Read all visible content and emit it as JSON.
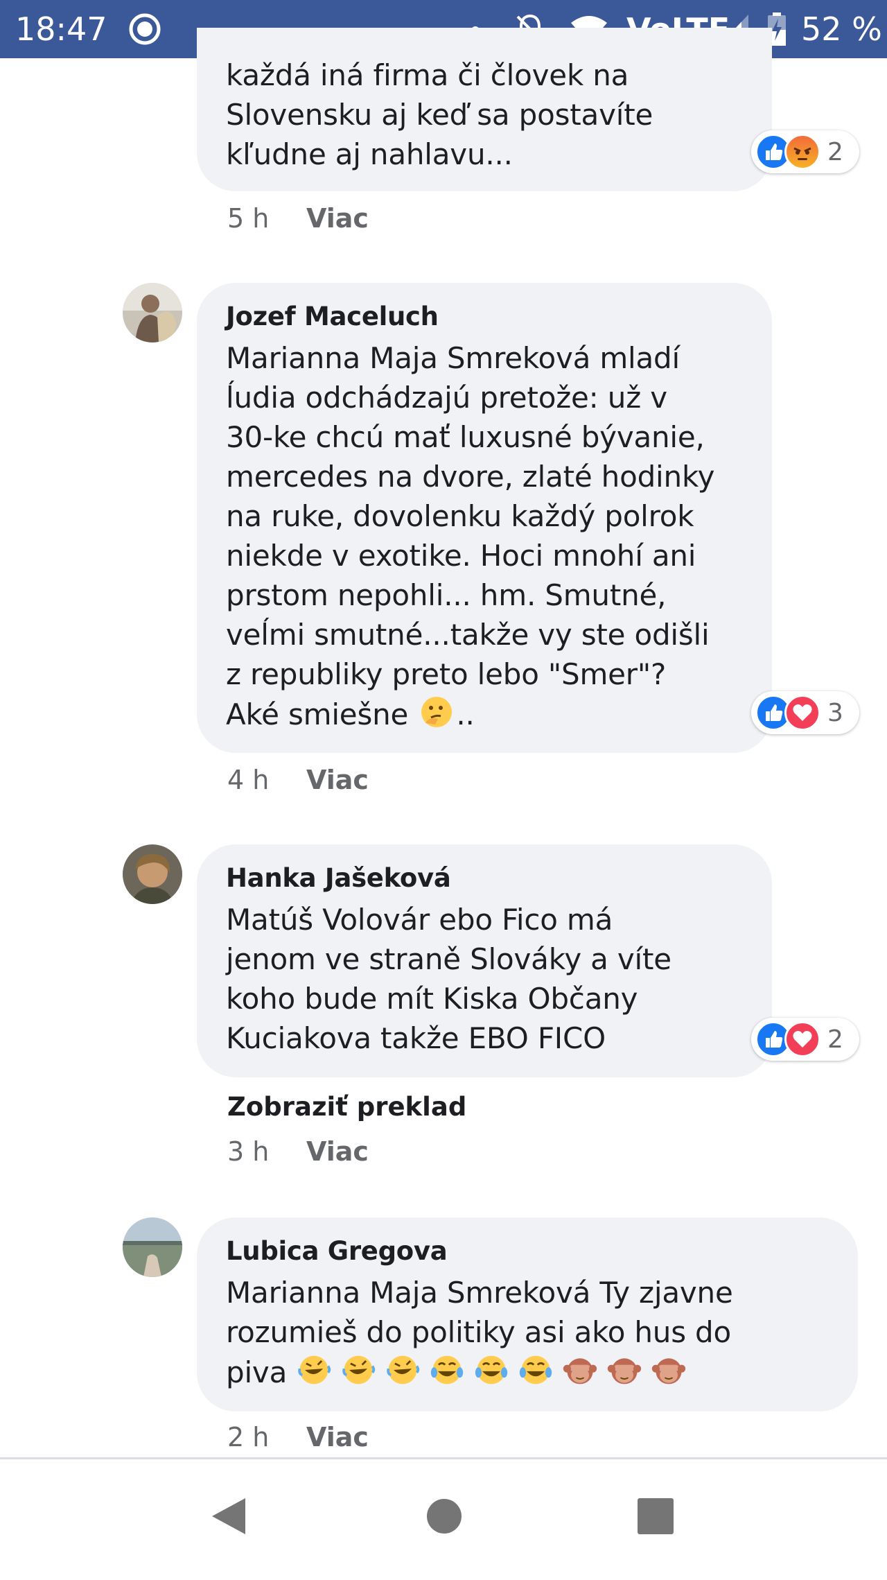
{
  "status_bar": {
    "time": "18:47",
    "battery_percent": "52 %",
    "network_label": "VoLTE",
    "signal_level": 0.75,
    "icons": [
      "sync-ring-icon",
      "notification-dot-icon",
      "silent-bell-icon",
      "wifi-icon",
      "volte-icon",
      "signal-icon",
      "battery-charging-icon"
    ]
  },
  "theme": {
    "brand_blue": "#3b5998",
    "bubble_bg": "#f0f2f5",
    "meta_gray": "#65676b",
    "like_blue": "#1877f2",
    "love_red": "#f33e58"
  },
  "comments": [
    {
      "author": "",
      "text_lines": "každá iná firma či človek na\nSlovensku aj keď sa postavíte\nkľudne aj nahlavu...",
      "reactions": [
        "like",
        "angry"
      ],
      "reaction_count": "2",
      "time": "5 h",
      "more_label": "Viac"
    },
    {
      "author": "Jozef Maceluch",
      "text_lines": "Marianna Maja Smreková mladí\nĺudia odchádzajú pretože: už v\n30-ke chcú mať luxusné bývanie,\nmercedes na dvore, zlaté hodinky\nna ruke, dovolenku každý polrok\nniekde v exotike. Hoci mnohí ani\nprstom nepohli... hm. Smutné,\nveĺmi smutné...takže vy ste odišli\nz republiky preto lebo \"Smer\"?",
      "last_line_prefix": "Aké smiešne ",
      "last_line_suffix": "..",
      "emoji": [
        "thinking-face-emoji"
      ],
      "reactions": [
        "like",
        "love"
      ],
      "reaction_count": "3",
      "time": "4 h",
      "more_label": "Viac"
    },
    {
      "author": "Hanka Jašeková",
      "text_lines": "Matúš Volovár ebo Fico má\njenom ve straně Slováky a víte\nkoho bude mít Kiska Občany\nKuciakova takže EBO FICO",
      "reactions": [
        "like",
        "love"
      ],
      "reaction_count": "2",
      "translate_label": "Zobraziť preklad",
      "time": "3 h",
      "more_label": "Viac"
    },
    {
      "author": "Lubica Gregova",
      "text_lines": "Marianna Maja Smreková Ty zjavne\nrozumieš do politiky asi ako hus do",
      "last_line_prefix": "piva ",
      "emoji": [
        "rofl-emoji",
        "rofl-emoji",
        "rofl-emoji",
        "tears-of-joy-emoji",
        "tears-of-joy-emoji",
        "tears-of-joy-emoji",
        "see-no-evil-monkey-emoji",
        "see-no-evil-monkey-emoji",
        "see-no-evil-monkey-emoji"
      ],
      "time": "2 h",
      "more_label": "Viac"
    }
  ],
  "nav_bar": {
    "buttons": [
      "back-icon",
      "home-icon",
      "recents-icon"
    ]
  }
}
